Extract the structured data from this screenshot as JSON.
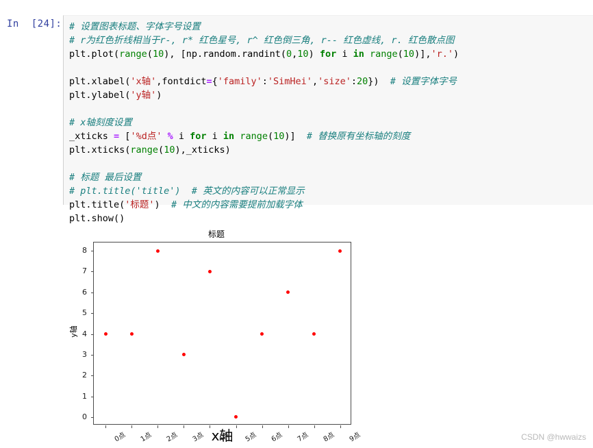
{
  "notebook": {
    "prompt": "In  [24]:",
    "code_lines": [
      [
        {
          "t": "# 设置图表标题、字体字号设置",
          "c": "cm"
        }
      ],
      [
        {
          "t": "# r为红色折线相当于r-, r* 红色星号, r^ 红色倒三角, r-- 红色虚线, r. 红色散点图",
          "c": "cm"
        }
      ],
      [
        {
          "t": "plt.plot(",
          "c": "pl"
        },
        {
          "t": "range",
          "c": "bi"
        },
        {
          "t": "(",
          "c": "pl"
        },
        {
          "t": "10",
          "c": "num"
        },
        {
          "t": "), [np.random.randint(",
          "c": "pl"
        },
        {
          "t": "0",
          "c": "num"
        },
        {
          "t": ",",
          "c": "pl"
        },
        {
          "t": "10",
          "c": "num"
        },
        {
          "t": ") ",
          "c": "pl"
        },
        {
          "t": "for",
          "c": "kw"
        },
        {
          "t": " i ",
          "c": "pl"
        },
        {
          "t": "in",
          "c": "kw"
        },
        {
          "t": " ",
          "c": "pl"
        },
        {
          "t": "range",
          "c": "bi"
        },
        {
          "t": "(",
          "c": "pl"
        },
        {
          "t": "10",
          "c": "num"
        },
        {
          "t": ")],",
          "c": "pl"
        },
        {
          "t": "'r.'",
          "c": "str"
        },
        {
          "t": ")",
          "c": "pl"
        }
      ],
      [
        {
          "t": " ",
          "c": "pl"
        }
      ],
      [
        {
          "t": "plt.xlabel(",
          "c": "pl"
        },
        {
          "t": "'x轴'",
          "c": "str"
        },
        {
          "t": ",fontdict",
          "c": "pl"
        },
        {
          "t": "=",
          "c": "op"
        },
        {
          "t": "{",
          "c": "pl"
        },
        {
          "t": "'family'",
          "c": "str"
        },
        {
          "t": ":",
          "c": "pl"
        },
        {
          "t": "'SimHei'",
          "c": "str"
        },
        {
          "t": ",",
          "c": "pl"
        },
        {
          "t": "'size'",
          "c": "str"
        },
        {
          "t": ":",
          "c": "pl"
        },
        {
          "t": "20",
          "c": "num"
        },
        {
          "t": "})  ",
          "c": "pl"
        },
        {
          "t": "# 设置字体字号",
          "c": "cm"
        }
      ],
      [
        {
          "t": "plt.ylabel(",
          "c": "pl"
        },
        {
          "t": "'y轴'",
          "c": "str"
        },
        {
          "t": ")",
          "c": "pl"
        }
      ],
      [
        {
          "t": " ",
          "c": "pl"
        }
      ],
      [
        {
          "t": "# x轴刻度设置",
          "c": "cm"
        }
      ],
      [
        {
          "t": "_xticks ",
          "c": "pl"
        },
        {
          "t": "=",
          "c": "op"
        },
        {
          "t": " [",
          "c": "pl"
        },
        {
          "t": "'%d点'",
          "c": "str"
        },
        {
          "t": " ",
          "c": "pl"
        },
        {
          "t": "%",
          "c": "op"
        },
        {
          "t": " i ",
          "c": "pl"
        },
        {
          "t": "for",
          "c": "kw"
        },
        {
          "t": " i ",
          "c": "pl"
        },
        {
          "t": "in",
          "c": "kw"
        },
        {
          "t": " ",
          "c": "pl"
        },
        {
          "t": "range",
          "c": "bi"
        },
        {
          "t": "(",
          "c": "pl"
        },
        {
          "t": "10",
          "c": "num"
        },
        {
          "t": ")]  ",
          "c": "pl"
        },
        {
          "t": "# 替换原有坐标轴的刻度",
          "c": "cm"
        }
      ],
      [
        {
          "t": "plt.xticks(",
          "c": "pl"
        },
        {
          "t": "range",
          "c": "bi"
        },
        {
          "t": "(",
          "c": "pl"
        },
        {
          "t": "10",
          "c": "num"
        },
        {
          "t": "),_xticks)",
          "c": "pl"
        }
      ],
      [
        {
          "t": " ",
          "c": "pl"
        }
      ],
      [
        {
          "t": "# 标题 最后设置",
          "c": "cm"
        }
      ],
      [
        {
          "t": "# plt.title('title')  # 英文的内容可以正常显示",
          "c": "cm"
        }
      ],
      [
        {
          "t": "plt.title(",
          "c": "pl"
        },
        {
          "t": "'标题'",
          "c": "str"
        },
        {
          "t": ")  ",
          "c": "pl"
        },
        {
          "t": "# 中文的内容需要提前加载字体",
          "c": "cm"
        }
      ],
      [
        {
          "t": "plt.show()",
          "c": "pl"
        }
      ]
    ]
  },
  "chart_data": {
    "type": "scatter",
    "title": "标题",
    "xlabel": "x轴",
    "ylabel": "y轴",
    "x": [
      0,
      1,
      2,
      3,
      4,
      5,
      6,
      7,
      8,
      9
    ],
    "values": [
      4,
      4,
      8,
      3,
      7,
      0,
      4,
      6,
      4,
      8
    ],
    "xtick_labels": [
      "0点",
      "1点",
      "2点",
      "3点",
      "4点",
      "5点",
      "6点",
      "7点",
      "8点",
      "9点"
    ],
    "ytick_labels": [
      "0",
      "1",
      "2",
      "3",
      "4",
      "5",
      "6",
      "7",
      "8"
    ],
    "ylim": [
      -0.4,
      8.4
    ],
    "xlim": [
      -0.45,
      9.45
    ],
    "grid": false,
    "legend": false,
    "marker_color": "#ff0000",
    "marker_style": "."
  },
  "watermark": {
    "text": "CSDN @hwwaizs"
  }
}
